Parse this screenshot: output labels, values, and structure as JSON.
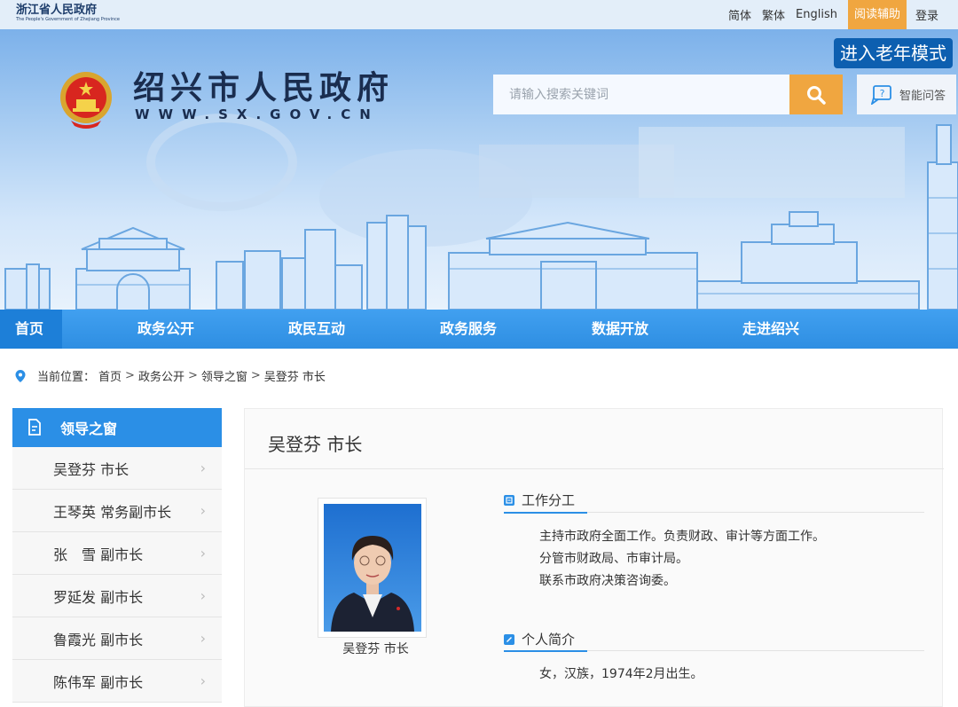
{
  "topbar": {
    "province_cn": "浙江省人民政府",
    "province_en": "The People's Government of Zhejiang Province",
    "links": [
      "简体",
      "繁体",
      "English"
    ],
    "reading_aid": "阅读辅助",
    "login": "登录"
  },
  "header": {
    "site_name": "绍兴市人民政府",
    "site_url": "WWW.SX.GOV.CN",
    "elder_mode": "进入老年模式",
    "search_placeholder": "请输入搜索关键词",
    "smart_qa": "智能问答"
  },
  "nav": [
    "首页",
    "政务公开",
    "政民互动",
    "政务服务",
    "数据开放",
    "走进绍兴"
  ],
  "breadcrumb": {
    "prefix": "当前位置：",
    "items": [
      "首页",
      "政务公开",
      "领导之窗",
      "吴登芬 市长"
    ]
  },
  "sidebar": {
    "title": "领导之窗",
    "items": [
      "吴登芬 市长",
      "王琴英 常务副市长",
      "张　雪 副市长",
      "罗延发 副市长",
      "鲁霞光 副市长",
      "陈伟军 副市长"
    ]
  },
  "main": {
    "title": "吴登芬 市长",
    "photo_caption": "吴登芬 市长",
    "duty_heading": "工作分工",
    "duty_lines": [
      "主持市政府全面工作。负责财政、审计等方面工作。",
      "分管市财政局、市审计局。",
      "联系市政府决策咨询委。"
    ],
    "profile_heading": "个人简介",
    "profile_lines": [
      "女，汉族，1974年2月出生。"
    ]
  },
  "colors": {
    "nav_blue": "#2e8ee2",
    "accent_orange": "#f0a640",
    "elder_blue": "#0d5fb0"
  }
}
